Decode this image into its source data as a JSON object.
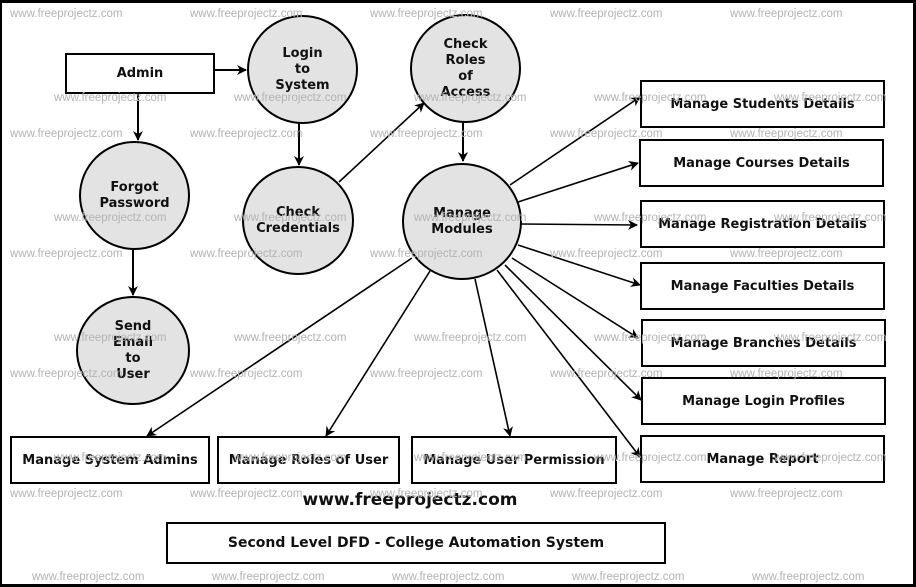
{
  "diagram": {
    "title": "Second Level DFD - College Automation System",
    "site_url": "www.freeprojectz.com",
    "watermark": "www.freeprojectz.com",
    "colors": {
      "process_fill": "#e3e3e3",
      "stroke": "#000000",
      "watermark": "#b3b3b3"
    },
    "entities": {
      "admin": "Admin",
      "manage_students": "Manage Students Details",
      "manage_courses": "Manage Courses Details",
      "manage_registration": "Manage Registration Details",
      "manage_faculties": "Manage Faculties Details",
      "manage_branches": "Manage Branches Details",
      "manage_login_profiles": "Manage Login Profiles",
      "manage_report": "Manage Report",
      "manage_system_admins": "Manage System Admins",
      "manage_roles_of_user": "Manage Roles of User",
      "manage_user_permission": "Manage User Permission"
    },
    "processes": {
      "login_to_system": [
        "Login",
        "to",
        "System"
      ],
      "forgot_password": [
        "Forgot",
        "Password"
      ],
      "send_email": [
        "Send",
        "Email",
        "to",
        "User"
      ],
      "check_credentials": [
        "Check",
        "Credentials"
      ],
      "check_roles": [
        "Check",
        "Roles",
        "of",
        "Access"
      ],
      "manage_modules": [
        "Manage",
        "Modules"
      ]
    },
    "flows": [
      {
        "from": "Admin",
        "to": "Login to System"
      },
      {
        "from": "Admin",
        "to": "Forgot Password"
      },
      {
        "from": "Forgot Password",
        "to": "Send Email to User"
      },
      {
        "from": "Login to System",
        "to": "Check Credentials"
      },
      {
        "from": "Check Credentials",
        "to": "Check Roles of Access"
      },
      {
        "from": "Check Roles of Access",
        "to": "Manage Modules"
      },
      {
        "from": "Manage Modules",
        "to": "Manage Students Details"
      },
      {
        "from": "Manage Modules",
        "to": "Manage Courses Details"
      },
      {
        "from": "Manage Modules",
        "to": "Manage Registration Details"
      },
      {
        "from": "Manage Modules",
        "to": "Manage Faculties Details"
      },
      {
        "from": "Manage Modules",
        "to": "Manage Branches Details"
      },
      {
        "from": "Manage Modules",
        "to": "Manage Login Profiles"
      },
      {
        "from": "Manage Modules",
        "to": "Manage Report"
      },
      {
        "from": "Manage Modules",
        "to": "Manage System Admins"
      },
      {
        "from": "Manage Modules",
        "to": "Manage Roles of User"
      },
      {
        "from": "Manage Modules",
        "to": "Manage User Permission"
      }
    ]
  }
}
